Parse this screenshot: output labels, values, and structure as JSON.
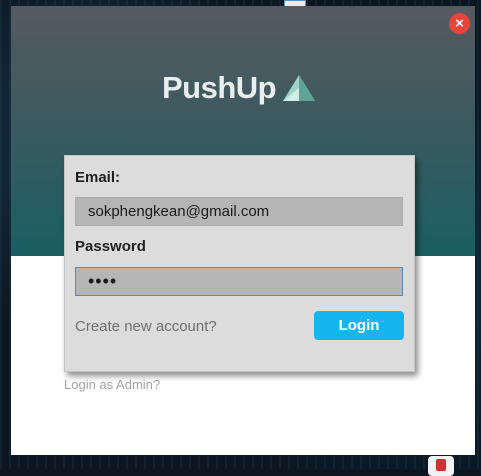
{
  "app": {
    "name": "PushUp",
    "brand_color": "#1a5f63",
    "logo_icon": "triangle-logo-icon"
  },
  "dialog": {
    "close_symbol": "×",
    "close_icon": "close-icon",
    "close_color": "#e8443a"
  },
  "form": {
    "email_label": "Email:",
    "email_value": "sokphengkean@gmail.com",
    "password_label": "Password",
    "password_value": "abcd",
    "create_account_link": "Create new account?",
    "login_button": "Login",
    "login_button_color": "#15b6ef"
  },
  "footer": {
    "admin_link": "Login as Admin?"
  }
}
